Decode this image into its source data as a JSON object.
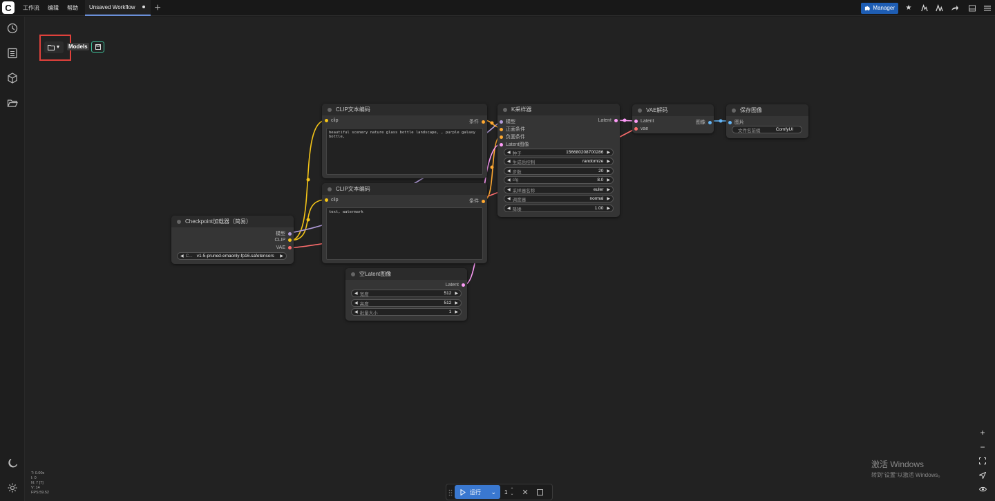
{
  "menu": {
    "workflow": "工作流",
    "edit": "编辑",
    "help": "帮助"
  },
  "tab": {
    "title": "Unsaved Workflow",
    "add": "+"
  },
  "top_right": {
    "manager": "Manager"
  },
  "models_panel": {
    "label": "Models"
  },
  "nodes": {
    "clip1": {
      "title": "CLIP文本编码",
      "input": "clip",
      "output": "条件",
      "text": "beautiful scenery nature glass bottle landscape, , purple galaxy bottle,"
    },
    "clip2": {
      "title": "CLIP文本编码",
      "input": "clip",
      "output": "条件",
      "text": "text, watermark"
    },
    "checkpoint": {
      "title": "Checkpoint加载器（简易）",
      "outputs": [
        "模型",
        "CLIP",
        "VAE"
      ],
      "widget_label": "C...",
      "widget_value": "v1-5-pruned-emaonly-fp16.safetensors"
    },
    "empty_latent": {
      "title": "空Latent图像",
      "output": "Latent",
      "widgets": [
        {
          "label": "宽度",
          "value": "512"
        },
        {
          "label": "高度",
          "value": "512"
        },
        {
          "label": "批量大小",
          "value": "1"
        }
      ]
    },
    "ksampler": {
      "title": "K采样器",
      "inputs": [
        "模型",
        "正面条件",
        "负面条件",
        "Latent图像"
      ],
      "output": "Latent",
      "widgets": [
        {
          "label": "种子",
          "value": "156680208700286"
        },
        {
          "label": "生成后控制",
          "value": "randomize"
        },
        {
          "label": "步数",
          "value": "20"
        },
        {
          "label": "cfg",
          "value": "8.0"
        },
        {
          "label": "采样器名称",
          "value": "euler"
        },
        {
          "label": "调度器",
          "value": "normal"
        },
        {
          "label": "降噪",
          "value": "1.00"
        }
      ]
    },
    "vae_decode": {
      "title": "VAE解码",
      "inputs": [
        "Latent",
        "vae"
      ],
      "output": "图像"
    },
    "save_image": {
      "title": "保存图像",
      "input": "图片",
      "widget_label": "文件名前缀",
      "widget_value": "ComfyUI"
    }
  },
  "stats": [
    "T: 0.00s",
    "I: 0",
    "N: 7 [7]",
    "V: 14",
    "FPS:59.52"
  ],
  "runbar": {
    "run_label": "运行",
    "count": "1"
  },
  "watermark": {
    "line1": "激活 Windows",
    "line2": "转到\"设置\"以激活 Windows。"
  },
  "colors": {
    "clip_wire": "#f5c518",
    "model_wire": "#b39ddb",
    "vae_wire": "#ff6e6e",
    "latent_wire": "#ff9cf9",
    "cond_wire": "#ffa931",
    "image_wire": "#64b5f6",
    "accent": "#3a78d0"
  }
}
